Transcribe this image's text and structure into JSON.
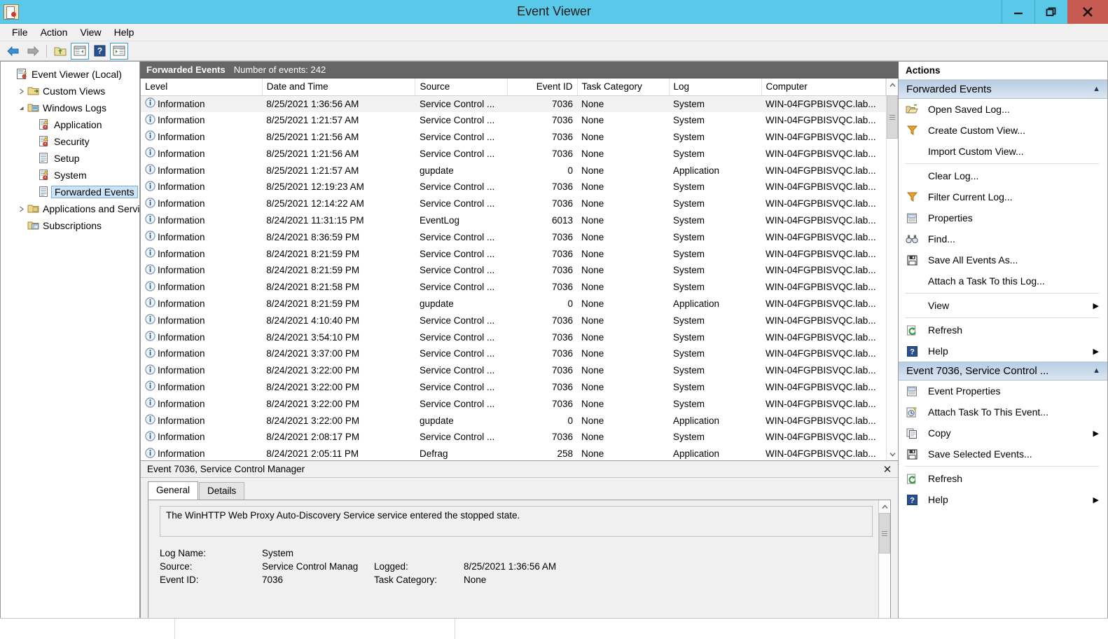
{
  "window": {
    "title": "Event Viewer",
    "icon": "event-viewer-icon",
    "minimize": "minimize",
    "maximize": "restore",
    "close": "close"
  },
  "menubar": [
    {
      "label": "File"
    },
    {
      "label": "Action"
    },
    {
      "label": "View"
    },
    {
      "label": "Help"
    }
  ],
  "toolbar": [
    {
      "name": "back-icon"
    },
    {
      "name": "forward-icon"
    },
    {
      "name": "up-folder-icon"
    },
    {
      "name": "show-console-tree-icon"
    },
    {
      "name": "help-icon"
    },
    {
      "name": "show-action-pane-icon"
    }
  ],
  "sidebar": {
    "items": [
      {
        "label": "Event Viewer (Local)",
        "indent": 0,
        "twisty": "none",
        "icon": "event-viewer-icon",
        "selected": false
      },
      {
        "label": "Custom Views",
        "indent": 1,
        "twisty": "collapsed",
        "icon": "custom-views-folder-icon",
        "selected": false
      },
      {
        "label": "Windows Logs",
        "indent": 1,
        "twisty": "expanded",
        "icon": "windows-logs-folder-icon",
        "selected": false
      },
      {
        "label": "Application",
        "indent": 2,
        "twisty": "none",
        "icon": "log-warning-icon",
        "selected": false
      },
      {
        "label": "Security",
        "indent": 2,
        "twisty": "none",
        "icon": "log-warning-icon",
        "selected": false
      },
      {
        "label": "Setup",
        "indent": 2,
        "twisty": "none",
        "icon": "log-icon",
        "selected": false
      },
      {
        "label": "System",
        "indent": 2,
        "twisty": "none",
        "icon": "log-warning-icon",
        "selected": false
      },
      {
        "label": "Forwarded Events",
        "indent": 2,
        "twisty": "none",
        "icon": "log-icon",
        "selected": true
      },
      {
        "label": "Applications and Servi",
        "indent": 1,
        "twisty": "collapsed",
        "icon": "folder-icon",
        "selected": false
      },
      {
        "label": "Subscriptions",
        "indent": 1,
        "twisty": "none",
        "icon": "subscriptions-icon",
        "selected": false
      }
    ],
    "hscroll": {
      "left_arrow": "‹",
      "right_arrow": "›",
      "grip": "III"
    }
  },
  "center": {
    "header": {
      "title": "Forwarded Events",
      "count_label": "Number of events: 242"
    },
    "columns": [
      "Level",
      "Date and Time",
      "Source",
      "Event ID",
      "Task Category",
      "Log",
      "Computer"
    ],
    "rows": [
      {
        "level": "Information",
        "datetime": "8/25/2021 1:36:56 AM",
        "source": "Service Control ...",
        "event_id": "7036",
        "task": "None",
        "log": "System",
        "computer": "WIN-04FGPBISVQC.lab...",
        "selected": true
      },
      {
        "level": "Information",
        "datetime": "8/25/2021 1:21:57 AM",
        "source": "Service Control ...",
        "event_id": "7036",
        "task": "None",
        "log": "System",
        "computer": "WIN-04FGPBISVQC.lab...",
        "selected": false
      },
      {
        "level": "Information",
        "datetime": "8/25/2021 1:21:56 AM",
        "source": "Service Control ...",
        "event_id": "7036",
        "task": "None",
        "log": "System",
        "computer": "WIN-04FGPBISVQC.lab...",
        "selected": false
      },
      {
        "level": "Information",
        "datetime": "8/25/2021 1:21:56 AM",
        "source": "Service Control ...",
        "event_id": "7036",
        "task": "None",
        "log": "System",
        "computer": "WIN-04FGPBISVQC.lab...",
        "selected": false
      },
      {
        "level": "Information",
        "datetime": "8/25/2021 1:21:57 AM",
        "source": "gupdate",
        "event_id": "0",
        "task": "None",
        "log": "Application",
        "computer": "WIN-04FGPBISVQC.lab...",
        "selected": false
      },
      {
        "level": "Information",
        "datetime": "8/25/2021 12:19:23 AM",
        "source": "Service Control ...",
        "event_id": "7036",
        "task": "None",
        "log": "System",
        "computer": "WIN-04FGPBISVQC.lab...",
        "selected": false
      },
      {
        "level": "Information",
        "datetime": "8/25/2021 12:14:22 AM",
        "source": "Service Control ...",
        "event_id": "7036",
        "task": "None",
        "log": "System",
        "computer": "WIN-04FGPBISVQC.lab...",
        "selected": false
      },
      {
        "level": "Information",
        "datetime": "8/24/2021 11:31:15 PM",
        "source": "EventLog",
        "event_id": "6013",
        "task": "None",
        "log": "System",
        "computer": "WIN-04FGPBISVQC.lab...",
        "selected": false
      },
      {
        "level": "Information",
        "datetime": "8/24/2021 8:36:59 PM",
        "source": "Service Control ...",
        "event_id": "7036",
        "task": "None",
        "log": "System",
        "computer": "WIN-04FGPBISVQC.lab...",
        "selected": false
      },
      {
        "level": "Information",
        "datetime": "8/24/2021 8:21:59 PM",
        "source": "Service Control ...",
        "event_id": "7036",
        "task": "None",
        "log": "System",
        "computer": "WIN-04FGPBISVQC.lab...",
        "selected": false
      },
      {
        "level": "Information",
        "datetime": "8/24/2021 8:21:59 PM",
        "source": "Service Control ...",
        "event_id": "7036",
        "task": "None",
        "log": "System",
        "computer": "WIN-04FGPBISVQC.lab...",
        "selected": false
      },
      {
        "level": "Information",
        "datetime": "8/24/2021 8:21:58 PM",
        "source": "Service Control ...",
        "event_id": "7036",
        "task": "None",
        "log": "System",
        "computer": "WIN-04FGPBISVQC.lab...",
        "selected": false
      },
      {
        "level": "Information",
        "datetime": "8/24/2021 8:21:59 PM",
        "source": "gupdate",
        "event_id": "0",
        "task": "None",
        "log": "Application",
        "computer": "WIN-04FGPBISVQC.lab...",
        "selected": false
      },
      {
        "level": "Information",
        "datetime": "8/24/2021 4:10:40 PM",
        "source": "Service Control ...",
        "event_id": "7036",
        "task": "None",
        "log": "System",
        "computer": "WIN-04FGPBISVQC.lab...",
        "selected": false
      },
      {
        "level": "Information",
        "datetime": "8/24/2021 3:54:10 PM",
        "source": "Service Control ...",
        "event_id": "7036",
        "task": "None",
        "log": "System",
        "computer": "WIN-04FGPBISVQC.lab...",
        "selected": false
      },
      {
        "level": "Information",
        "datetime": "8/24/2021 3:37:00 PM",
        "source": "Service Control ...",
        "event_id": "7036",
        "task": "None",
        "log": "System",
        "computer": "WIN-04FGPBISVQC.lab...",
        "selected": false
      },
      {
        "level": "Information",
        "datetime": "8/24/2021 3:22:00 PM",
        "source": "Service Control ...",
        "event_id": "7036",
        "task": "None",
        "log": "System",
        "computer": "WIN-04FGPBISVQC.lab...",
        "selected": false
      },
      {
        "level": "Information",
        "datetime": "8/24/2021 3:22:00 PM",
        "source": "Service Control ...",
        "event_id": "7036",
        "task": "None",
        "log": "System",
        "computer": "WIN-04FGPBISVQC.lab...",
        "selected": false
      },
      {
        "level": "Information",
        "datetime": "8/24/2021 3:22:00 PM",
        "source": "Service Control ...",
        "event_id": "7036",
        "task": "None",
        "log": "System",
        "computer": "WIN-04FGPBISVQC.lab...",
        "selected": false
      },
      {
        "level": "Information",
        "datetime": "8/24/2021 3:22:00 PM",
        "source": "gupdate",
        "event_id": "0",
        "task": "None",
        "log": "Application",
        "computer": "WIN-04FGPBISVQC.lab...",
        "selected": false
      },
      {
        "level": "Information",
        "datetime": "8/24/2021 2:08:17 PM",
        "source": "Service Control ...",
        "event_id": "7036",
        "task": "None",
        "log": "System",
        "computer": "WIN-04FGPBISVQC.lab...",
        "selected": false
      },
      {
        "level": "Information",
        "datetime": "8/24/2021 2:05:11 PM",
        "source": "Defrag",
        "event_id": "258",
        "task": "None",
        "log": "Application",
        "computer": "WIN-04FGPBISVQC.lab...",
        "selected": false
      }
    ]
  },
  "details": {
    "title": "Event 7036, Service Control Manager",
    "close_label": "✕",
    "tabs": [
      {
        "label": "General",
        "active": true
      },
      {
        "label": "Details",
        "active": false
      }
    ],
    "message": "The WinHTTP Web Proxy Auto-Discovery Service service entered the stopped state.",
    "meta": {
      "log_name_label": "Log Name:",
      "log_name_value": "System",
      "source_label": "Source:",
      "source_value": "Service Control Manag",
      "logged_label": "Logged:",
      "logged_value": "8/25/2021 1:36:56 AM",
      "event_id_label": "Event ID:",
      "event_id_value": "7036",
      "task_category_label": "Task Category:",
      "task_category_value": "None"
    }
  },
  "actions": {
    "title": "Actions",
    "groups": [
      {
        "header": "Forwarded Events",
        "caret": "▲",
        "items": [
          {
            "label": "Open Saved Log...",
            "icon": "open-folder-icon",
            "submenu": false,
            "separator_before": false
          },
          {
            "label": "Create Custom View...",
            "icon": "filter-icon",
            "submenu": false,
            "separator_before": false
          },
          {
            "label": "Import Custom View...",
            "icon": "none",
            "submenu": false,
            "separator_before": false
          },
          {
            "label": "Clear Log...",
            "icon": "none",
            "submenu": false,
            "separator_before": true
          },
          {
            "label": "Filter Current Log...",
            "icon": "filter-icon",
            "submenu": false,
            "separator_before": false
          },
          {
            "label": "Properties",
            "icon": "properties-icon",
            "submenu": false,
            "separator_before": false
          },
          {
            "label": "Find...",
            "icon": "binoculars-icon",
            "submenu": false,
            "separator_before": false
          },
          {
            "label": "Save All Events As...",
            "icon": "save-icon",
            "submenu": false,
            "separator_before": false
          },
          {
            "label": "Attach a Task To this Log...",
            "icon": "none",
            "submenu": false,
            "separator_before": false
          },
          {
            "label": "View",
            "icon": "none",
            "submenu": true,
            "separator_before": true
          },
          {
            "label": "Refresh",
            "icon": "refresh-icon",
            "submenu": false,
            "separator_before": true
          },
          {
            "label": "Help",
            "icon": "help-icon",
            "submenu": true,
            "separator_before": false
          }
        ]
      },
      {
        "header": "Event 7036, Service Control ...",
        "caret": "▲",
        "items": [
          {
            "label": "Event Properties",
            "icon": "properties-icon",
            "submenu": false,
            "separator_before": false
          },
          {
            "label": "Attach Task To This Event...",
            "icon": "attach-task-icon",
            "submenu": false,
            "separator_before": false
          },
          {
            "label": "Copy",
            "icon": "copy-icon",
            "submenu": true,
            "separator_before": false
          },
          {
            "label": "Save Selected Events...",
            "icon": "save-icon",
            "submenu": false,
            "separator_before": false
          },
          {
            "label": "Refresh",
            "icon": "refresh-icon",
            "submenu": false,
            "separator_before": true
          },
          {
            "label": "Help",
            "icon": "help-icon",
            "submenu": true,
            "separator_before": false
          }
        ]
      }
    ],
    "submenu_arrow": "▶"
  },
  "colors": {
    "titlebar": "#5ac8e8",
    "close_button": "#c75b52",
    "header_bar": "#666666",
    "group_header": "#b6cbe3",
    "selection": "#cce4f7",
    "row_selected": "#f2f2f2"
  }
}
